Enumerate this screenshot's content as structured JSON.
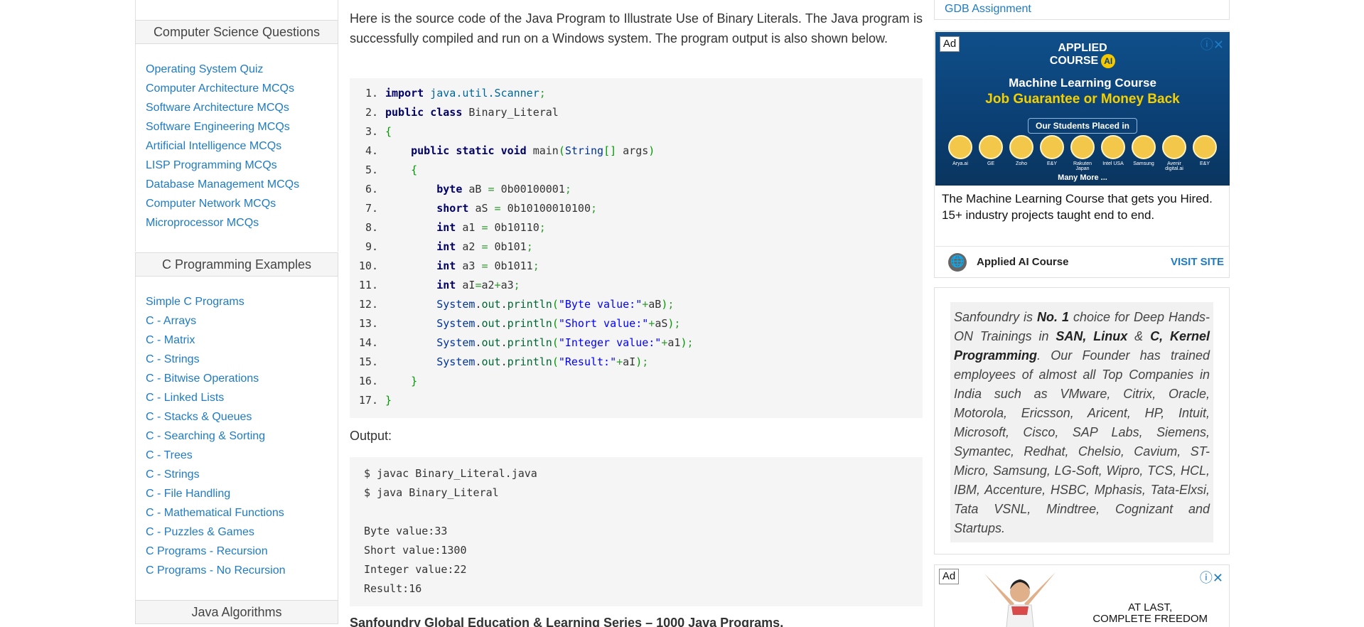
{
  "sidebar": {
    "sections": [
      {
        "title": "Computer Science Questions",
        "items": [
          "Operating System Quiz",
          "Computer Architecture MCQs",
          "Software Architecture MCQs",
          "Software Engineering MCQs",
          "Artificial Intelligence MCQs",
          "LISP Programming MCQs",
          "Database Management MCQs",
          "Computer Network MCQs",
          "Microprocessor MCQs"
        ]
      },
      {
        "title": "C Programming Examples",
        "items": [
          "Simple C Programs",
          "C - Arrays",
          "C - Matrix",
          "C - Strings",
          "C - Bitwise Operations",
          "C - Linked Lists",
          "C - Stacks & Queues",
          "C - Searching & Sorting",
          "C - Trees",
          "C - Strings",
          "C - File Handling",
          "C - Mathematical Functions",
          "C - Puzzles & Games",
          "C Programs - Recursion",
          "C Programs - No Recursion"
        ]
      },
      {
        "title": "Java Algorithms",
        "items": []
      }
    ]
  },
  "main": {
    "intro": "Here is the source code of the Java Program to Illustrate Use of Binary Literals. The Java program is successfully compiled and run on a Windows system. The program output is also shown below.",
    "code_lines": [
      "import java.util.Scanner;",
      "public class Binary_Literal",
      "{",
      "    public static void main(String[] args)",
      "    {",
      "        byte aB = 0b00100001;",
      "        short aS = 0b10100010100;",
      "        int a1 = 0b10110;",
      "        int a2 = 0b101;",
      "        int a3 = 0b1011;",
      "        int aI=a2+a3;",
      "        System.out.println(\"Byte value:\"+aB);",
      "        System.out.println(\"Short value:\"+aS);",
      "        System.out.println(\"Integer value:\"+a1);",
      "        System.out.println(\"Result:\"+aI);",
      "    }",
      "}"
    ],
    "output_label": "Output:",
    "output_lines": [
      "$ javac Binary_Literal.java",
      "$ java Binary_Literal",
      "",
      "Byte value:33",
      "Short value:1300",
      "Integer value:22",
      "Result:16"
    ],
    "bottom_heading": "Sanfoundry Global Education & Learning Series – 1000 Java Programs."
  },
  "right": {
    "top_link": "GDB Assignment",
    "ad1": {
      "tag": "Ad",
      "logo_line1": "APPLIED",
      "logo_line2": "COURSE",
      "logo_mark": "AI",
      "headline": "Machine Learning Course",
      "subheadline": "Job Guarantee or Money Back",
      "placed_label": "Our Students Placed in",
      "companies": [
        "Arya.ai",
        "GE",
        "Zoho",
        "E&Y",
        "Rakuten Japan",
        "Intel USA",
        "Samsung",
        "Avenir digital.ai",
        "E&Y"
      ],
      "more": "Many More ...",
      "description": "The Machine Learning Course that gets you Hired. 15+ industry projects taught end to end.",
      "brand": "Applied AI Course",
      "cta": "VISIT SITE"
    },
    "promo_html_parts": {
      "p1": "Sanfoundry is ",
      "b1": "No. 1",
      "p2": " choice for Deep Hands-ON Trainings in ",
      "b2": "SAN, Linux",
      "p3": " & ",
      "b3": "C, Kernel Programming",
      "p4": ". Our Founder has trained employees of almost all Top Companies in India such as VMware, Citrix, Oracle, Motorola, Ericsson, Aricent, HP, Intuit, Microsoft, Cisco, SAP Labs, Siemens, Symantec, Redhat, Chelsio, Cavium, ST-Micro, Samsung, LG-Soft, Wipro, TCS, HCL, IBM, Accenture, HSBC, Mphasis, Tata-Elxsi, Tata VSNL, Mindtree, Cognizant and Startups."
    },
    "ad2": {
      "tag": "Ad",
      "text_line1": "AT LAST,",
      "text_line2": "COMPLETE FREEDOM"
    }
  },
  "colors": {
    "link": "#1e7bc4",
    "code_bg": "#f5f5f5",
    "ad_banner": "#0b3f73",
    "ad_highlight": "#f5d000"
  }
}
